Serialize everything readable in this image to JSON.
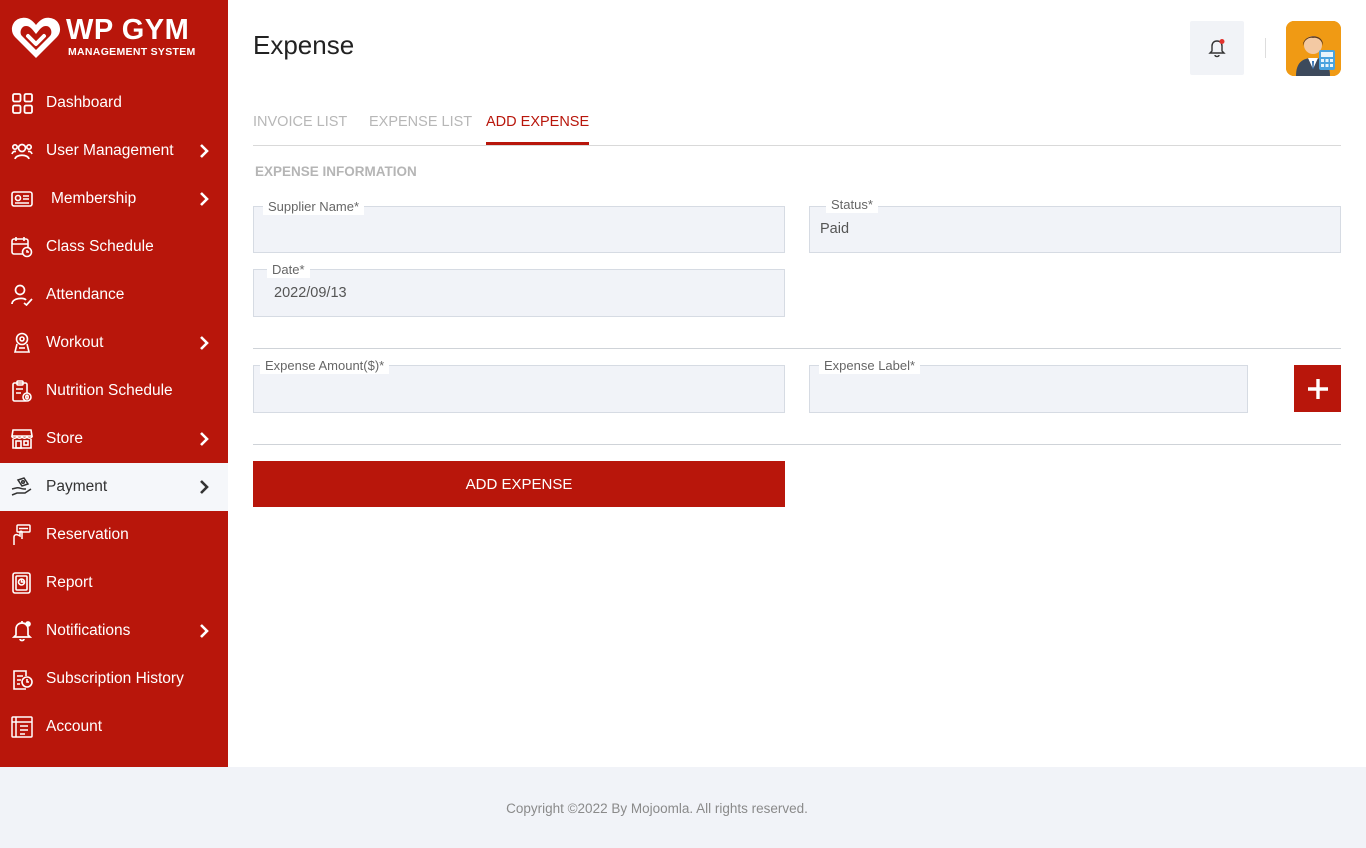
{
  "brand": {
    "title": "WP GYM",
    "subtitle": "MANAGEMENT SYSTEM",
    "accent": "#b8160b"
  },
  "sidebar": {
    "items": [
      {
        "label": "Dashboard",
        "icon": "dashboard-icon",
        "has_submenu": false,
        "active": false
      },
      {
        "label": "User Management",
        "icon": "users-icon",
        "has_submenu": true,
        "active": false
      },
      {
        "label": "Membership",
        "icon": "membership-card-icon",
        "has_submenu": true,
        "active": false
      },
      {
        "label": "Class Schedule",
        "icon": "calendar-icon",
        "has_submenu": false,
        "active": false
      },
      {
        "label": "Attendance",
        "icon": "user-check-icon",
        "has_submenu": false,
        "active": false
      },
      {
        "label": "Workout",
        "icon": "workout-icon",
        "has_submenu": true,
        "active": false
      },
      {
        "label": "Nutrition Schedule",
        "icon": "nutrition-icon",
        "has_submenu": false,
        "active": false
      },
      {
        "label": "Store",
        "icon": "store-icon",
        "has_submenu": true,
        "active": false
      },
      {
        "label": "Payment",
        "icon": "payment-icon",
        "has_submenu": true,
        "active": true
      },
      {
        "label": "Reservation",
        "icon": "reservation-icon",
        "has_submenu": false,
        "active": false
      },
      {
        "label": "Report",
        "icon": "report-icon",
        "has_submenu": false,
        "active": false
      },
      {
        "label": "Notifications",
        "icon": "bell-icon",
        "has_submenu": true,
        "active": false
      },
      {
        "label": "Subscription History",
        "icon": "subscription-icon",
        "has_submenu": false,
        "active": false
      },
      {
        "label": "Account",
        "icon": "account-icon",
        "has_submenu": false,
        "active": false
      }
    ]
  },
  "header": {
    "title": "Expense"
  },
  "tabs": [
    {
      "label": "INVOICE LIST",
      "active": false
    },
    {
      "label": "EXPENSE LIST",
      "active": false
    },
    {
      "label": "ADD EXPENSE",
      "active": true
    }
  ],
  "form": {
    "section_title": "EXPENSE INFORMATION",
    "supplier_name": {
      "label": "Supplier Name*",
      "value": ""
    },
    "status": {
      "label": "Status*",
      "value": "Paid"
    },
    "date": {
      "label": "Date*",
      "value": "2022/09/13"
    },
    "expense_amount": {
      "label": "Expense Amount($)*",
      "value": ""
    },
    "expense_label": {
      "label": "Expense Label*",
      "value": ""
    },
    "submit_label": "ADD EXPENSE"
  },
  "footer": {
    "text": "Copyright ©2022 By Mojoomla. All rights reserved."
  }
}
